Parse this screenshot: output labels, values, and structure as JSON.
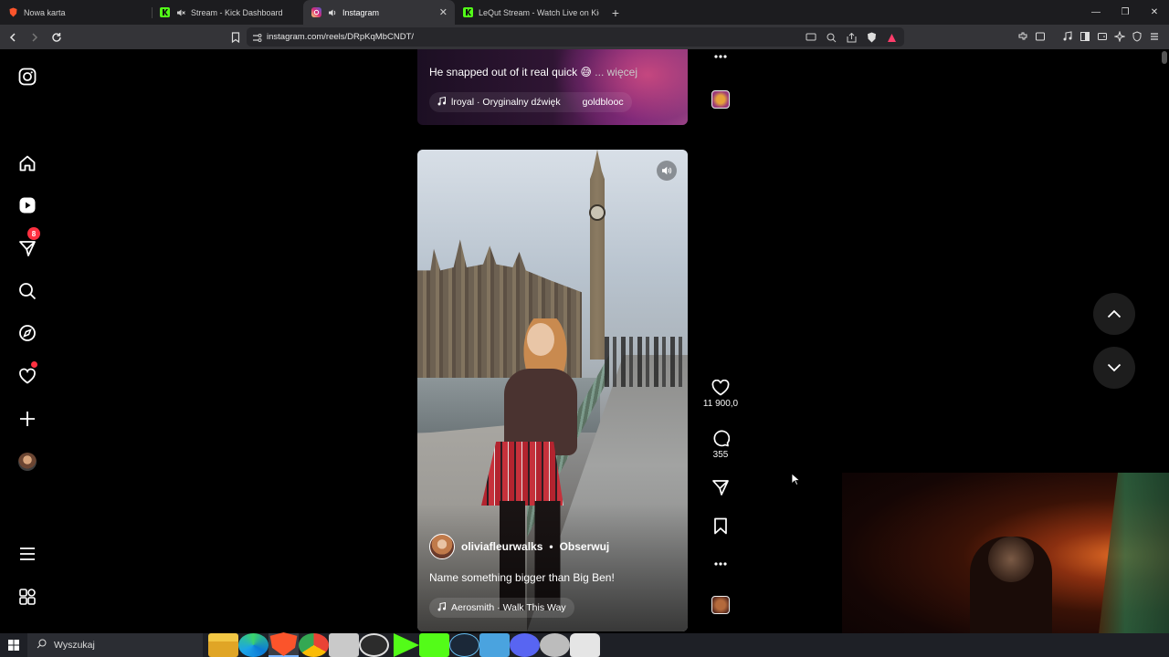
{
  "browser": {
    "tabs": [
      {
        "title": "Nowa karta",
        "active": false
      },
      {
        "title": "Stream - Kick Dashboard",
        "active": false
      },
      {
        "title": "Instagram",
        "active": true
      },
      {
        "title": "LeQut Stream - Watch Live on Kick",
        "active": false
      }
    ],
    "url": "instagram.com/reels/DRpKqMbCNDT/"
  },
  "sidebar": {
    "messages_badge": "8"
  },
  "reel_prev": {
    "caption": "He snapped out of it real quick 😅",
    "more_label": "... więcej",
    "music": "lroyal · Oryginalny dźwięk",
    "music_extra": "goldblooc"
  },
  "reel": {
    "username": "oliviafleurwalks",
    "separator": "•",
    "follow_label": "Obserwuj",
    "caption": "Name something bigger than Big Ben!",
    "music": "Aerosmith · Walk This Way",
    "likes": "11 900,0",
    "comments": "355"
  },
  "taskbar": {
    "search_placeholder": "Wyszukaj"
  },
  "colors": {
    "badge": "#ff3040",
    "chrome_dark": "#1c1c1f",
    "chrome_toolbar": "#343438"
  }
}
